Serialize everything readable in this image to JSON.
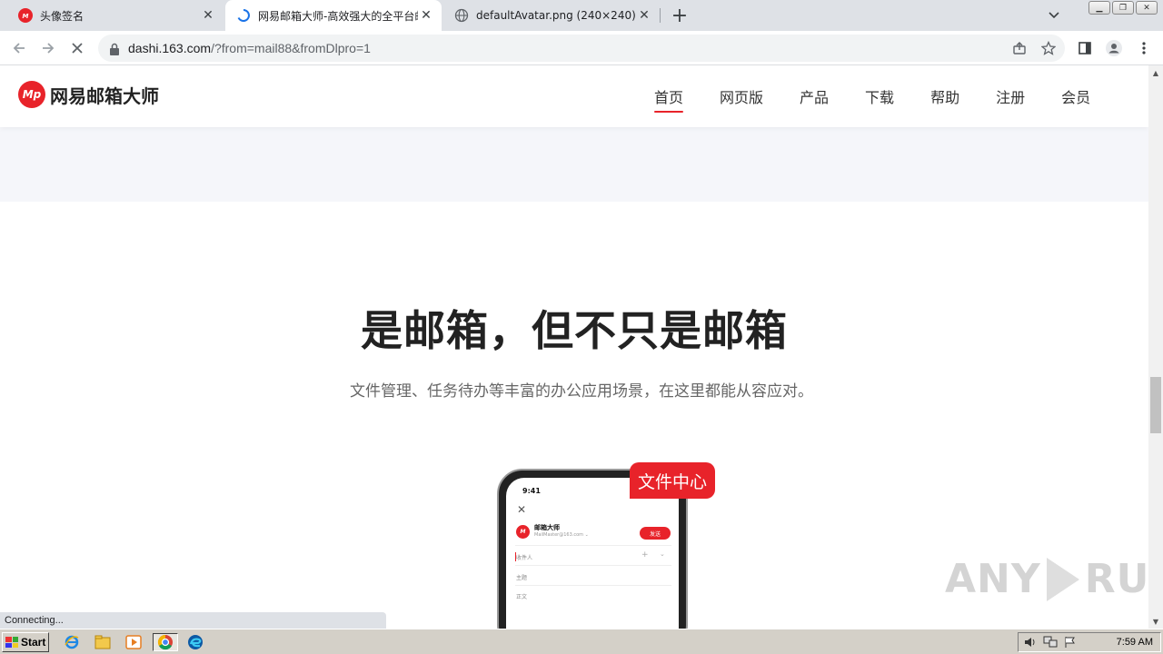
{
  "browser": {
    "tabs": [
      {
        "title": "头像签名",
        "icon": "netease-logo-icon"
      },
      {
        "title": "网易邮箱大师-高效强大的全平台邮箱",
        "icon": "loading-spinner-icon"
      },
      {
        "title": "defaultAvatar.png (240×240)",
        "icon": "globe-icon"
      }
    ],
    "url_host": "dashi.163.com",
    "url_rest": "/?from=mail88&fromDlpro=1",
    "status": "Connecting..."
  },
  "site": {
    "logo_text": "网易邮箱大师",
    "logo_mark": "Mp",
    "nav": [
      {
        "label": "首页",
        "active": true
      },
      {
        "label": "网页版"
      },
      {
        "label": "产品"
      },
      {
        "label": "下载"
      },
      {
        "label": "帮助"
      },
      {
        "label": "注册"
      },
      {
        "label": "会员"
      }
    ],
    "headline": "是邮箱，但不只是邮箱",
    "subline": "文件管理、任务待办等丰富的办公应用场景，在这里都能从容应对。",
    "badge": "文件中心",
    "phone": {
      "time": "9:41",
      "account_name": "邮箱大师",
      "account_email": "MailMaster@163.com ⌄",
      "send_label": "发送",
      "fields": [
        "收件人",
        "主题",
        "正文"
      ]
    }
  },
  "watermark": {
    "left": "ANY",
    "right": "RUN"
  },
  "taskbar": {
    "start_label": "Start",
    "clock": "7:59 AM"
  },
  "colors": {
    "brand_red": "#e8232a",
    "band": "#f5f6fa"
  }
}
